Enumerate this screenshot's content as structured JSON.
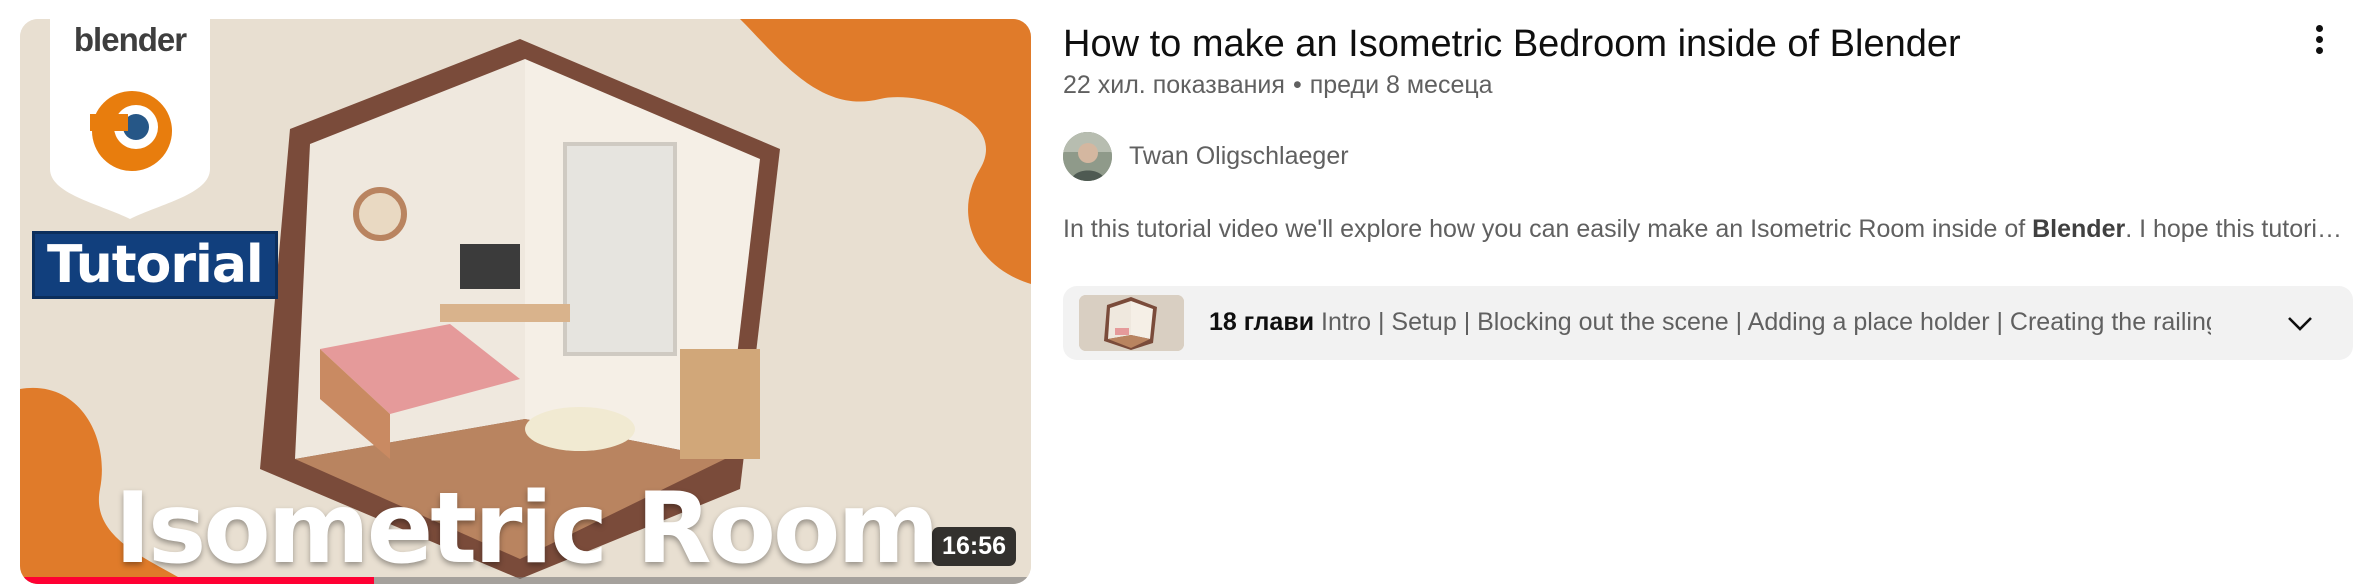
{
  "video": {
    "duration": "16:56",
    "progress_fraction": 0.35,
    "thumbnail": {
      "badge_text": "blender",
      "tag_text": "Tutorial",
      "headline": "Isometric Room"
    },
    "title": "How to make an Isometric Bedroom inside of Blender",
    "views": "22 хил. показвания",
    "separator": "•",
    "age": "преди 8 месеца",
    "channel_name": "Twan Oligschlaeger",
    "description_before": "In this tutorial video we'll explore how you can easily make an Isometric Room inside of ",
    "description_bold": "Blender",
    "description_after": ". I hope this tutorial helps you",
    "chapters": {
      "count_label": "18 глави",
      "list": "Intro | Setup | Blocking out the scene | Adding a place holder | Creating the railing |…"
    },
    "icons": {
      "more": "more-vert-icon",
      "expand": "chevron-down-icon"
    },
    "colors": {
      "progress": "#ff0033",
      "orange": "#e07b2a",
      "tag_bg": "#113f7d"
    }
  }
}
